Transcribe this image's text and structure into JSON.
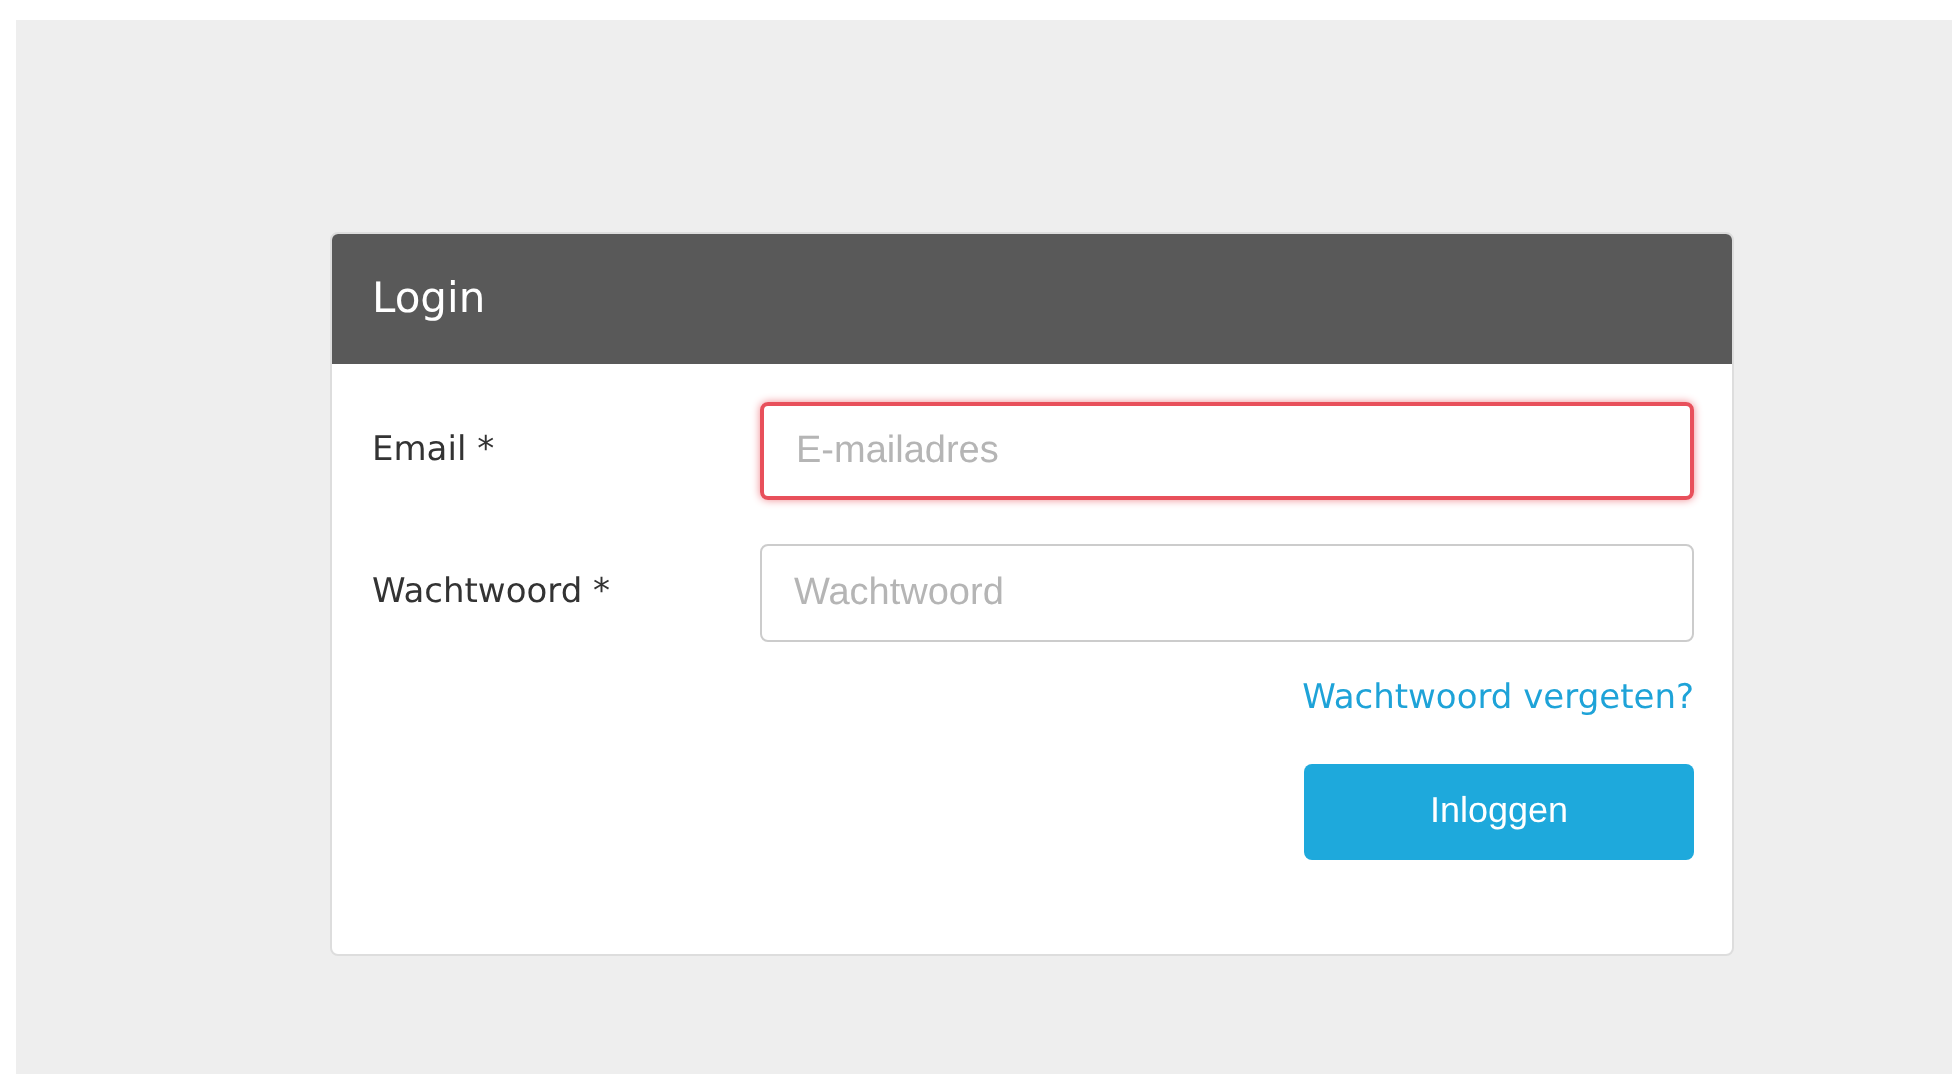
{
  "panel": {
    "title": "Login"
  },
  "fields": [
    {
      "label": "Email *",
      "placeholder": "E-mailadres",
      "invalid": true
    },
    {
      "label": "Wachtwoord *",
      "placeholder": "Wachtwoord",
      "invalid": false
    }
  ],
  "forgot_link": "Wachtwoord vergeten?",
  "submit_button": "Inloggen"
}
